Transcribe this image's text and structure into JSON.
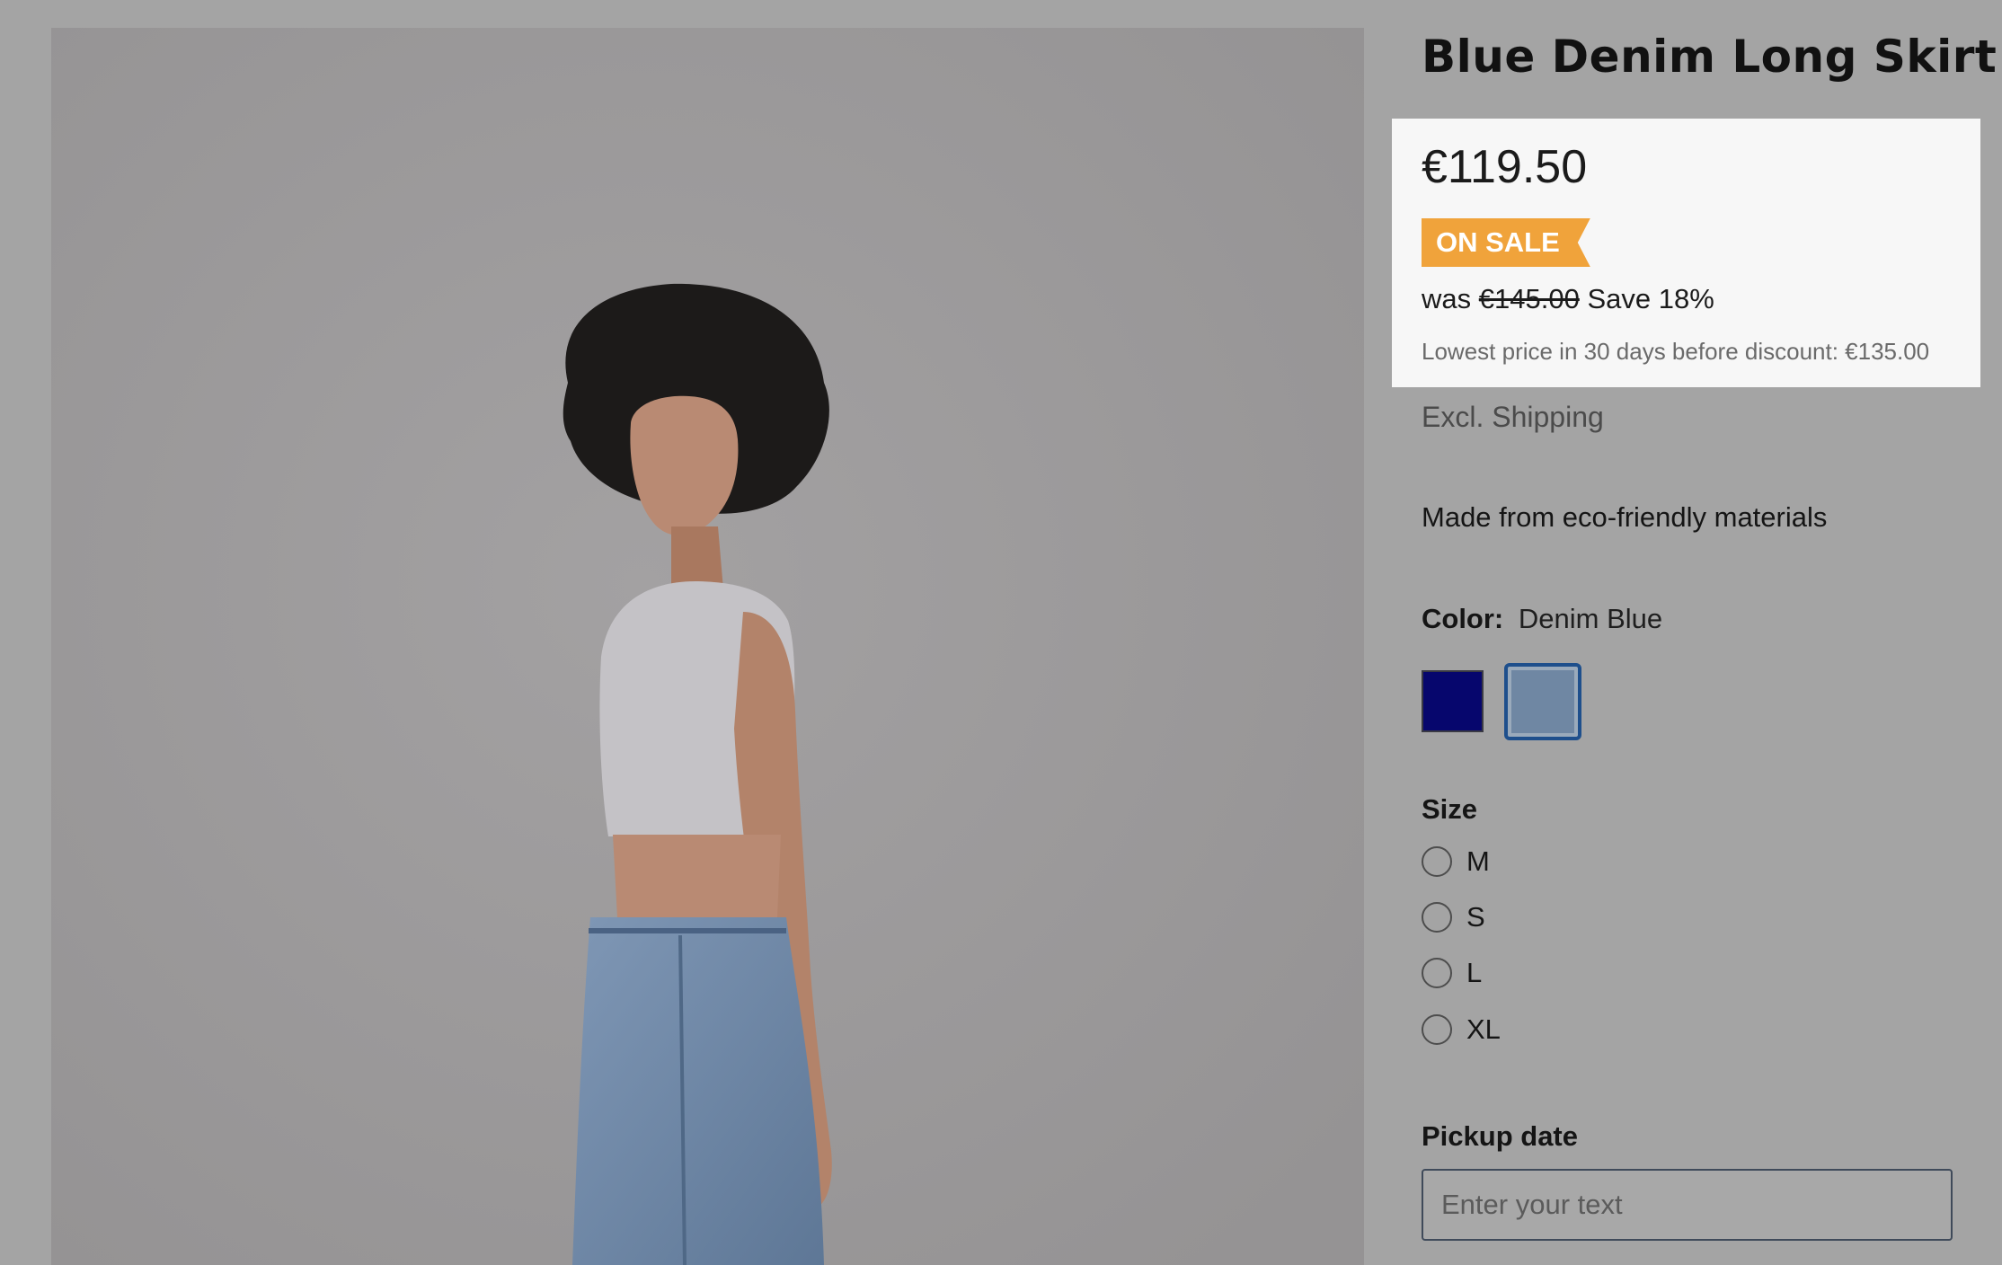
{
  "product": {
    "title": "Blue Denim Long Skirt",
    "image_alt": "Model wearing blue denim long skirt"
  },
  "pricing": {
    "current_price": "€119.50",
    "badge": "ON SALE",
    "was_label": "was",
    "old_price": "€145.00",
    "save_text": "Save 18%",
    "lowest_price_note": "Lowest price in 30 days before discount: €135.00",
    "badge_color": "#f0a33b"
  },
  "shipping_note": "Excl. Shipping",
  "description": "Made from eco-friendly materials",
  "color": {
    "label": "Color:",
    "selected": "Denim Blue",
    "swatches": [
      {
        "name": "Navy",
        "hex": "#06066d",
        "selected": false
      },
      {
        "name": "Denim Blue",
        "hex": "#6f87a3",
        "selected": true
      }
    ]
  },
  "size": {
    "label": "Size",
    "options": [
      "M",
      "S",
      "L",
      "XL"
    ]
  },
  "pickup": {
    "label": "Pickup date",
    "placeholder": "Enter your text",
    "value": ""
  }
}
